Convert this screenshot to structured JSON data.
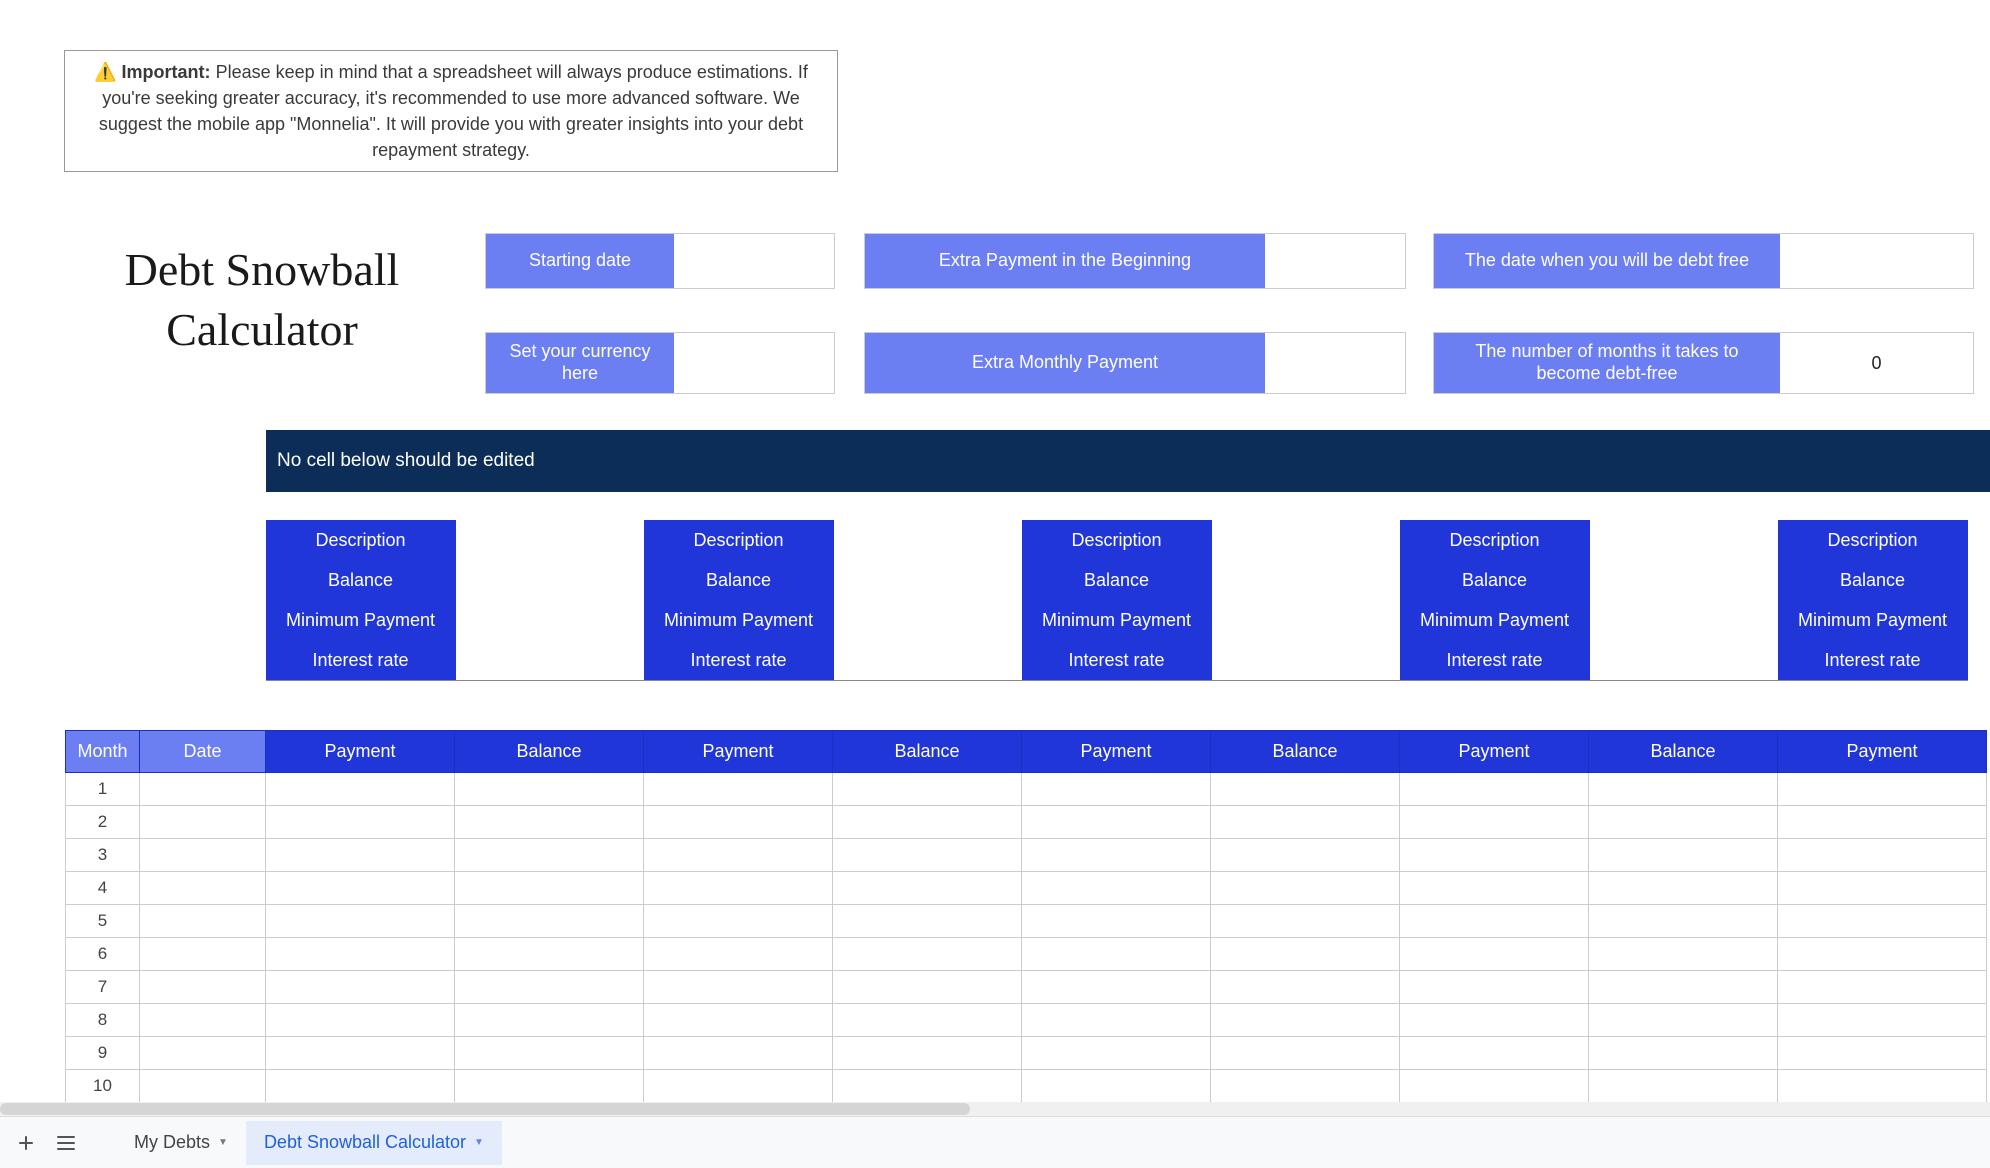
{
  "notice": {
    "icon": "⚠️",
    "label": "Important:",
    "text": "Please keep in mind that a spreadsheet will always produce estimations. If you're seeking greater accuracy, it's recommended to use more advanced software. We suggest the mobile app \"Monnelia\". It will provide you with greater insights into your debt repayment strategy."
  },
  "title_line1": "Debt Snowball",
  "title_line2": "Calculator",
  "params": {
    "starting_date_label": "Starting date",
    "starting_date_value": "",
    "currency_label": "Set your currency here",
    "currency_value": "",
    "extra_begin_label": "Extra Payment in the Beginning",
    "extra_begin_value": "",
    "extra_monthly_label": "Extra Monthly Payment",
    "extra_monthly_value": "",
    "debt_free_date_label": "The date when you will be debt free",
    "debt_free_date_value": "",
    "months_label": "The number of months it takes to become debt-free",
    "months_value": "0"
  },
  "no_edit_banner": "No cell below should be edited",
  "debt_headers": {
    "description": "Description",
    "balance": "Balance",
    "min_payment": "Minimum Payment",
    "interest_rate": "Interest rate"
  },
  "debt_columns": 5,
  "schedule_headers": {
    "month": "Month",
    "date": "Date",
    "payment": "Payment",
    "balance": "Balance"
  },
  "schedule_rows": [
    1,
    2,
    3,
    4,
    5,
    6,
    7,
    8,
    9,
    10
  ],
  "tabs": {
    "sheet1": "My Debts",
    "sheet2": "Debt Snowball Calculator"
  },
  "chart_data": {
    "type": "table",
    "title": "Debt Snowball Calculator",
    "parameters": {
      "starting_date": "",
      "currency": "",
      "extra_payment_beginning": "",
      "extra_monthly_payment": "",
      "debt_free_date": "",
      "months_to_debt_free": 0
    },
    "debts": [
      {
        "description": "",
        "balance": "",
        "minimum_payment": "",
        "interest_rate": ""
      },
      {
        "description": "",
        "balance": "",
        "minimum_payment": "",
        "interest_rate": ""
      },
      {
        "description": "",
        "balance": "",
        "minimum_payment": "",
        "interest_rate": ""
      },
      {
        "description": "",
        "balance": "",
        "minimum_payment": "",
        "interest_rate": ""
      },
      {
        "description": "",
        "balance": "",
        "minimum_payment": "",
        "interest_rate": ""
      }
    ],
    "schedule": []
  }
}
